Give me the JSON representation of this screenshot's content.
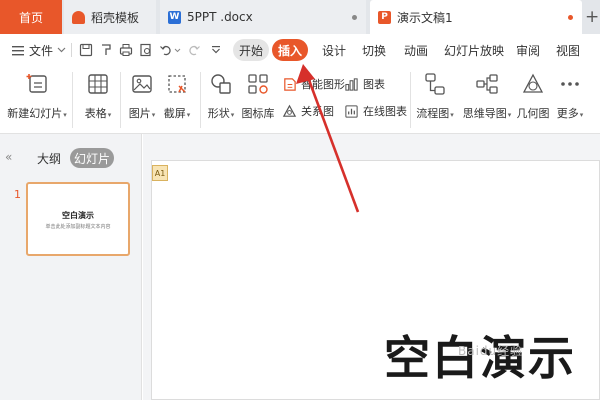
{
  "tabs": {
    "home": "首页",
    "items": [
      {
        "title": "稻壳模板",
        "icon": "docer-shell-icon"
      },
      {
        "title": "5PPT .docx",
        "icon": "wps-writer-icon",
        "icon_text": "W"
      },
      {
        "title": "演示文稿1",
        "icon": "wps-presentation-icon",
        "icon_text": "P"
      }
    ],
    "new_tab": "+"
  },
  "menu": {
    "file_label": "文件",
    "pill_start": "开始",
    "pill_insert": "插入",
    "items": [
      "设计",
      "切换",
      "动画",
      "幻灯片放映",
      "审阅",
      "视图"
    ]
  },
  "ribbon": {
    "new_slide": "新建幻灯片",
    "table": "表格",
    "picture": "图片",
    "screenshot": "截屏",
    "shape": "形状",
    "icon_library": "图标库",
    "smart_graphic": "智能图形",
    "relation_graph": "关系图",
    "chart": "图表",
    "online_chart": "在线图表",
    "flowchart": "流程图",
    "mind_map": "思维导图",
    "geometry": "几何图",
    "more": "更多"
  },
  "left_panel": {
    "outline_tab": "大纲",
    "slides_tab": "幻灯片",
    "collapse": "«",
    "slide_number": "1",
    "thumb_title": "空白演示",
    "thumb_subtitle": "单击此处添加副标题文本内容"
  },
  "canvas": {
    "placeholder_tag": "A1",
    "slide_title": "空白演示",
    "watermark": "Baidu经验"
  },
  "colors": {
    "accent": "#e8572a",
    "arrow": "#d6302b"
  }
}
